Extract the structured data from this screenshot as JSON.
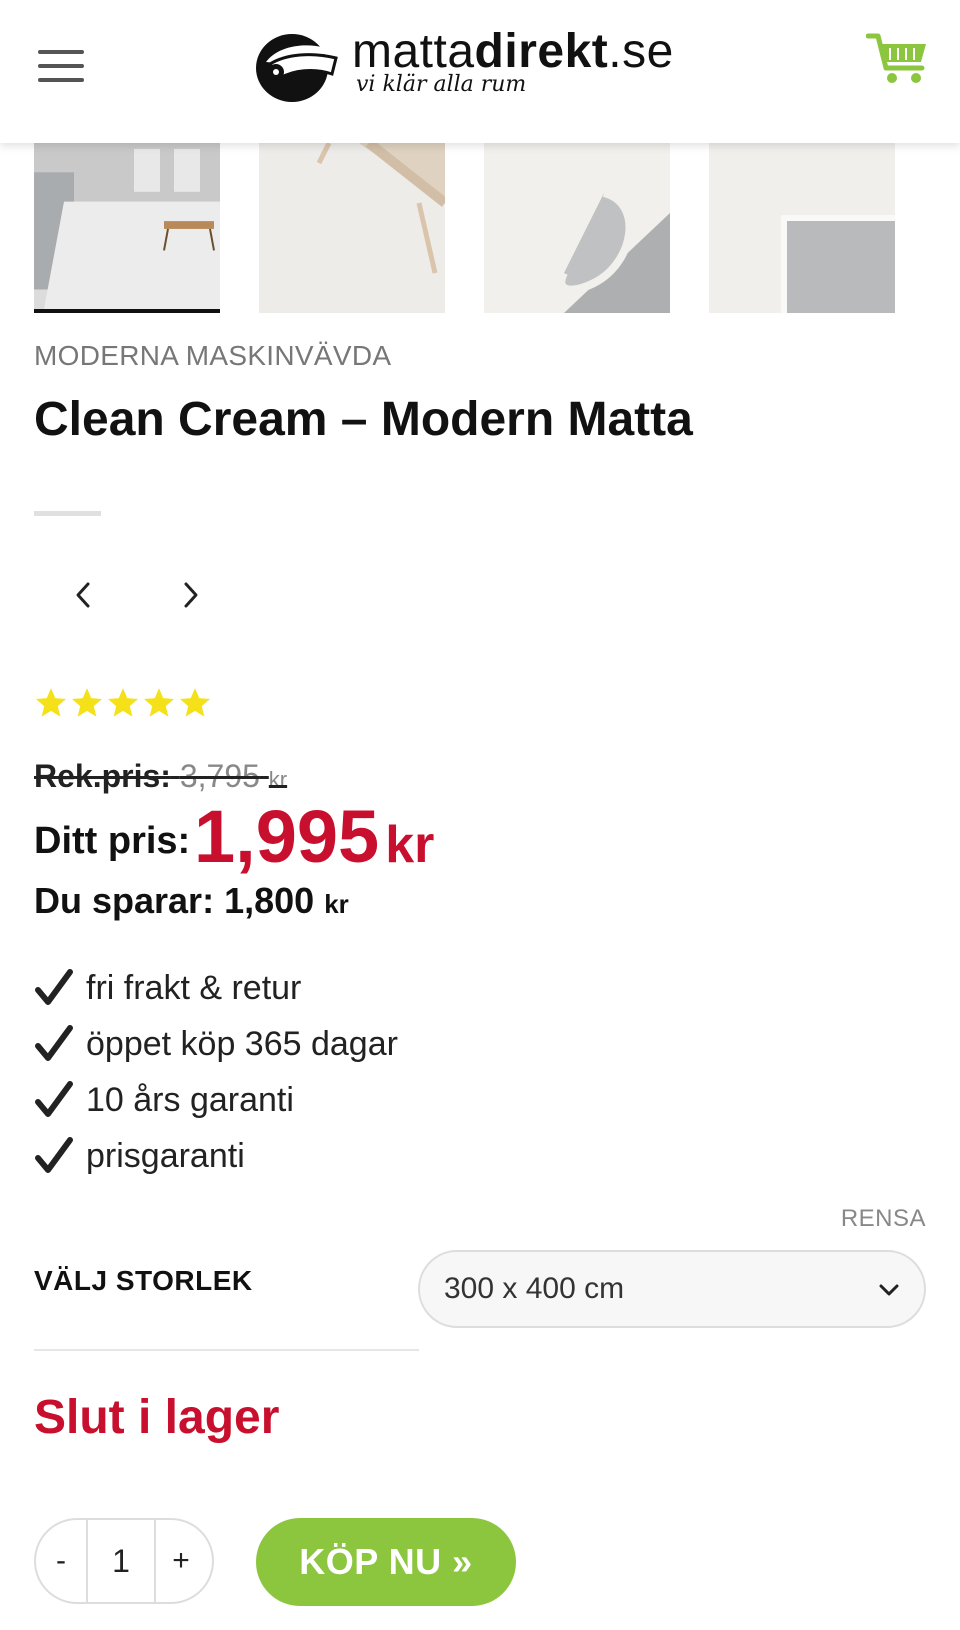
{
  "header": {
    "logo_light": "matta",
    "logo_bold": "direkt",
    "logo_suffix": ".se",
    "tagline": "vi klär alla rum",
    "icons": {
      "menu": "hamburger-menu-icon",
      "cart": "shopping-cart-icon"
    },
    "cart_color": "#8cc63f"
  },
  "gallery": {
    "thumbnails": [
      "living-room-rug",
      "rug-with-bench",
      "rug-rolled-edge",
      "rug-corner-closeup"
    ],
    "active_index": 0
  },
  "product": {
    "category": "MODERNA MASKINVÄVDA",
    "title": "Clean Cream – Modern Matta",
    "rating_stars": 5,
    "star_color": "#f5e11a"
  },
  "pricing": {
    "rek_label": "Rek.pris:",
    "rek_value": "3,795",
    "rek_currency": "kr",
    "price_label": "Ditt pris:",
    "price_value": "1,995",
    "price_currency": "kr",
    "save_label": "Du sparar:",
    "save_value": "1,800",
    "save_currency": "kr",
    "price_color": "#c8102e"
  },
  "usp": [
    "fri frakt & retur",
    "öppet köp 365 dagar",
    "10 års garanti",
    "prisgaranti"
  ],
  "variation": {
    "clear_label": "RENSA",
    "size_label": "VÄLJ STORLEK",
    "selected_size": "300 x 400 cm"
  },
  "stock": {
    "status": "Slut i lager"
  },
  "cart_form": {
    "minus": "-",
    "quantity": "1",
    "plus": "+",
    "buy_label": "KÖP NU »",
    "buy_color": "#8cc63f"
  }
}
